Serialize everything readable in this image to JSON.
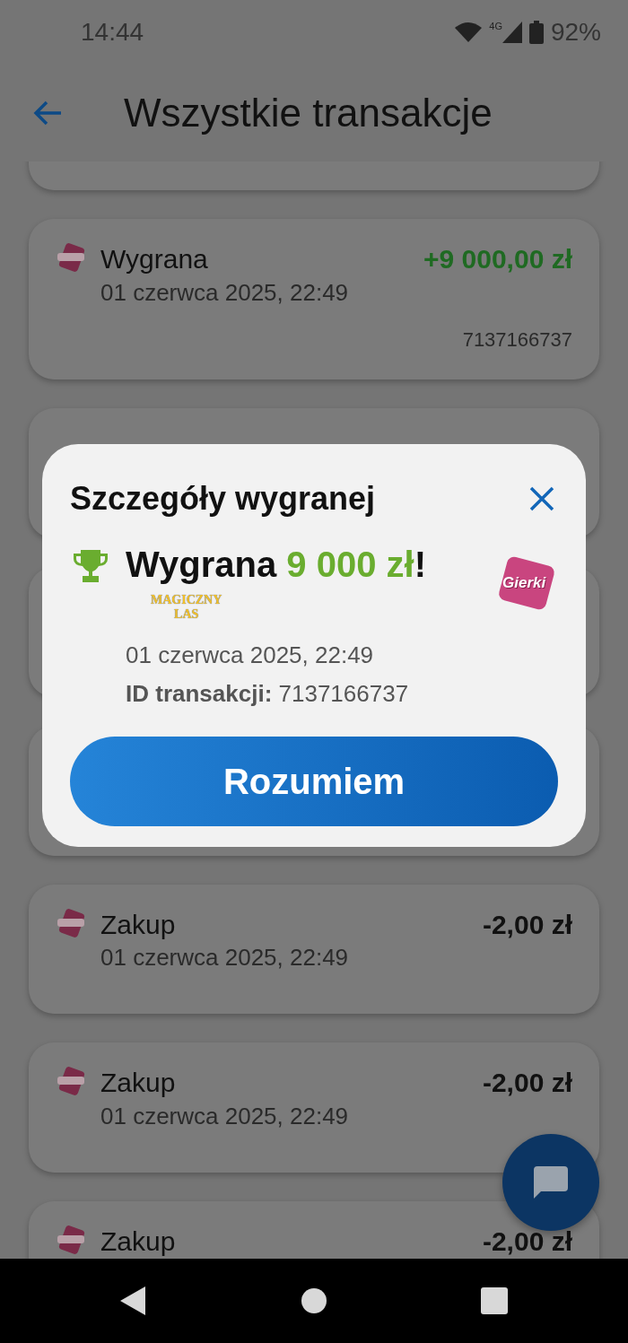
{
  "status_bar": {
    "time": "14:44",
    "network": "4G",
    "battery": "92%"
  },
  "header": {
    "title": "Wszystkie transakcje"
  },
  "transactions": [
    {
      "kind": "stub"
    },
    {
      "kind": "full",
      "title": "Wygrana",
      "date": "01 czerwca 2025, 22:49",
      "amount": "+9 000,00 zł",
      "positive": true,
      "transaction_id": "7137166737"
    },
    {
      "kind": "covered"
    },
    {
      "kind": "covered"
    },
    {
      "kind": "covered"
    },
    {
      "kind": "full",
      "title": "Zakup",
      "date": "01 czerwca 2025, 22:49",
      "amount": "-2,00 zł",
      "positive": false
    },
    {
      "kind": "full",
      "title": "Zakup",
      "date": "01 czerwca 2025, 22:49",
      "amount": "-2,00 zł",
      "positive": false
    },
    {
      "kind": "full",
      "title": "Zakup",
      "amount": "-2,00 zł",
      "positive": false
    }
  ],
  "dialog": {
    "title": "Szczegóły wygranej",
    "headline": "Wygrana",
    "amount": "9 000 zł",
    "headline_end": "!",
    "game_logo_lines": [
      "MAGICZNY",
      "LAS"
    ],
    "brand_logo": "Gierki",
    "date": "01 czerwca 2025, 22:49",
    "transaction_id": "**ID transakcji:** 7137166737",
    "button": "Rozumiem"
  }
}
